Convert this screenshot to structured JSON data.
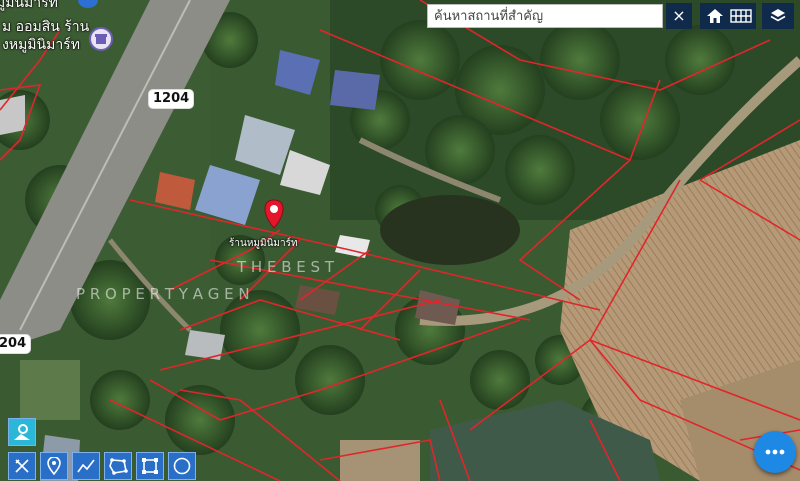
{
  "search": {
    "placeholder": "ค้นหาสถานที่สำคัญ",
    "value": ""
  },
  "controls": {
    "clear_symbol": "×",
    "home_icon": "home-icon",
    "grid_icon": "grid-icon",
    "layers_icon": "layers-icon"
  },
  "map": {
    "road_signs": [
      "1204",
      "1204",
      "204"
    ],
    "poi_lines": [
      "ม ออมสิน ร้าน",
      "งหมูมินิมาร์ท"
    ],
    "poi_partial": "มูมินิมาร์ท",
    "pin_label": "ร้านหมูมินิมาร์ท",
    "watermark_line1": "T H E   B E S T",
    "watermark_line2": "P R O P E R T Y   A G E N",
    "pin_color": "#e3162b",
    "parcel_color": "#e0262b"
  },
  "tools": [
    {
      "name": "street-view-tool",
      "icon": "street-view-icon"
    },
    {
      "name": "measure-tool",
      "icon": "ruler-icon"
    },
    {
      "name": "marker-tool",
      "icon": "marker-icon"
    },
    {
      "name": "polyline-tool",
      "icon": "polyline-icon"
    },
    {
      "name": "polygon-tool",
      "icon": "polygon-icon"
    },
    {
      "name": "rectangle-tool",
      "icon": "rectangle-icon"
    },
    {
      "name": "circle-tool",
      "icon": "circle-icon"
    }
  ],
  "fab": {
    "icon": "more-icon"
  }
}
